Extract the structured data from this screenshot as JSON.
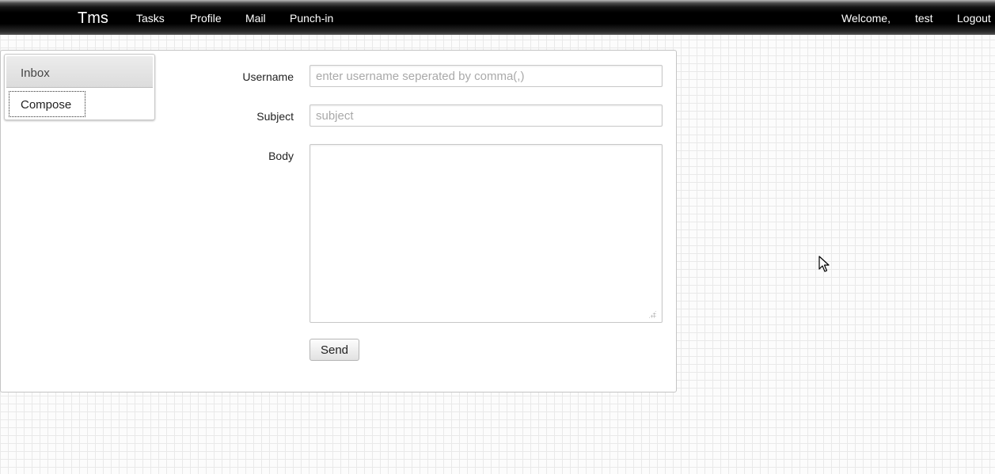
{
  "navbar": {
    "brand": "Tms",
    "items": [
      {
        "label": "Tasks"
      },
      {
        "label": "Profile"
      },
      {
        "label": "Mail"
      },
      {
        "label": "Punch-in"
      }
    ],
    "welcome": "Welcome,",
    "username": "test",
    "logout": "Logout"
  },
  "sidebar": {
    "items": [
      {
        "label": "Inbox"
      },
      {
        "label": "Compose"
      }
    ]
  },
  "form": {
    "username_label": "Username",
    "username_value": "",
    "username_placeholder": "enter username seperated by comma(,)",
    "subject_label": "Subject",
    "subject_value": "",
    "subject_placeholder": "subject",
    "body_label": "Body",
    "body_value": "",
    "send_label": "Send"
  },
  "colors": {
    "navbar_bg": "#000000",
    "nav_text": "#ffffff",
    "placeholder": "#a9a9a9"
  },
  "icons": {
    "cursor": "mouse-pointer-icon",
    "resize": "resize-grip-icon"
  }
}
